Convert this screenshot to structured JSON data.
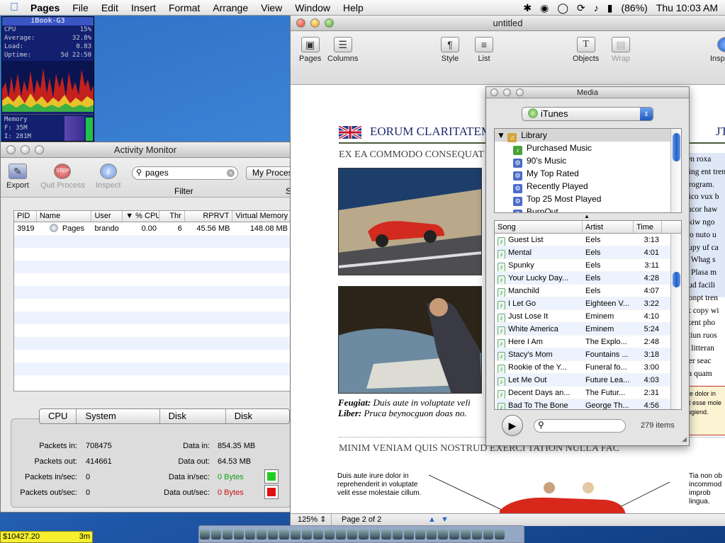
{
  "menubar": {
    "app": "Pages",
    "items": [
      "File",
      "Edit",
      "Insert",
      "Format",
      "Arrange",
      "View",
      "Window",
      "Help"
    ],
    "battery": "(86%)",
    "clock": "Thu 10:03 AM"
  },
  "ibook_widget": {
    "title": "iBook-G3",
    "rows": [
      {
        "label": "CPU",
        "value": "15%"
      },
      {
        "label": "Average:",
        "value": "32.8%"
      },
      {
        "label": "Load:",
        "value": "0.83"
      },
      {
        "label": "Uptime:",
        "value": "5d 22:50"
      }
    ],
    "memory_label": "Memory",
    "mem_f": "F: 35M",
    "mem_i": "I: 281M"
  },
  "activity_monitor": {
    "title": "Activity Monitor",
    "toolbar": {
      "export": "Export",
      "quit": "Quit Process",
      "inspect": "Inspect",
      "filter_label": "Filter",
      "search_value": "pages",
      "show_value": "My Processes"
    },
    "columns": [
      "PID",
      "Name",
      "User",
      "% CPU",
      "Thr",
      "RPRVT",
      "Virtual Memory"
    ],
    "rows": [
      {
        "pid": "3919",
        "name": "Pages",
        "user": "brando",
        "cpu": "0.00",
        "thr": "6",
        "rprvt": "45.56 MB",
        "vm": "148.08 MB"
      }
    ],
    "tabs": [
      "CPU",
      "System Memory",
      "Disk Activity",
      "Disk Usage"
    ],
    "stats": {
      "packets_in_label": "Packets in:",
      "packets_in": "708475",
      "packets_out_label": "Packets out:",
      "packets_out": "414661",
      "packets_in_sec_label": "Packets in/sec:",
      "packets_in_sec": "0",
      "packets_out_sec_label": "Packets out/sec:",
      "packets_out_sec": "0",
      "data_in_label": "Data in:",
      "data_in": "854.35 MB",
      "data_out_label": "Data out:",
      "data_out": "64.53 MB",
      "data_in_sec_label": "Data in/sec:",
      "data_in_sec": "0 Bytes",
      "data_out_sec_label": "Data out/sec:",
      "data_out_sec": "0 Bytes"
    }
  },
  "pages": {
    "title": "untitled",
    "toolbar": [
      "Pages",
      "Columns",
      "Style",
      "List",
      "Objects",
      "Wrap",
      "Inspector"
    ],
    "doc": {
      "heading1": "EORUM CLARITATEM",
      "heading2": "EX EA COMMODO CONSEQUAT",
      "caption_b1": "Feugiat:",
      "caption_t1": " Duis aute in voluptate veli",
      "caption_b2": "Liber:",
      "caption_t2": " Pruca beynocguon doas no.",
      "heading3": "MINIM VENIAM QUIS NOSTRUD EXERCI TATION NULLA FAC",
      "left_para": "Duis aute irure dolor in reprehenderit in voluptate velit esse molestaie cillum.",
      "right_para": "Tia non ob incommod improb lingua.",
      "side_text": [
        "len roxa",
        "king ent tren",
        "program.",
        "vico vux b",
        "rucor haw",
        "akiw ngo",
        "rto nuto u",
        "cupy uf ca",
        "t. Whag s",
        "t. Plasa m",
        "eud facili",
        "ponpt tren",
        "ix copy wi",
        "ixent pho",
        "ztiun ruos",
        "it litteran",
        "per seac",
        "ca quam"
      ],
      "box_text": [
        "re dolor in",
        "it esse mole",
        "ugiend."
      ],
      "jt": "JT"
    },
    "status": {
      "zoom": "125%",
      "page": "Page 2 of 2"
    }
  },
  "media": {
    "title": "Media",
    "source": "iTunes",
    "library": "Library",
    "playlists": [
      "Purchased Music",
      "90's Music",
      "My Top Rated",
      "Recently Played",
      "Top 25 Most Played",
      "BurnOut"
    ],
    "columns": [
      "Song",
      "Artist",
      "Time"
    ],
    "songs": [
      {
        "song": "Guest List",
        "artist": "Eels",
        "time": "3:13"
      },
      {
        "song": "Mental",
        "artist": "Eels",
        "time": "4:01"
      },
      {
        "song": "Spunky",
        "artist": "Eels",
        "time": "3:11"
      },
      {
        "song": "Your Lucky Day...",
        "artist": "Eels",
        "time": "4:28"
      },
      {
        "song": "Manchild",
        "artist": "Eels",
        "time": "4:07"
      },
      {
        "song": "I Let Go",
        "artist": "Eighteen V...",
        "time": "3:22"
      },
      {
        "song": "Just Lose It",
        "artist": "Eminem",
        "time": "4:10"
      },
      {
        "song": "White America",
        "artist": "Eminem",
        "time": "5:24"
      },
      {
        "song": "Here I Am",
        "artist": "The Explo...",
        "time": "2:48"
      },
      {
        "song": "Stacy's Mom",
        "artist": "Fountains ...",
        "time": "3:18"
      },
      {
        "song": "Rookie of the Y...",
        "artist": "Funeral fo...",
        "time": "3:00"
      },
      {
        "song": "Let Me Out",
        "artist": "Future Lea...",
        "time": "4:03"
      },
      {
        "song": "Decent Days an...",
        "artist": "The Futur...",
        "time": "2:31"
      },
      {
        "song": "Bad To The Bone",
        "artist": "George Th...",
        "time": "4:56"
      }
    ],
    "count": "279 items"
  },
  "stock": {
    "value": "$10427.20",
    "time": "3m"
  },
  "colors": {
    "accent": "#2a64c8",
    "green_led": "#22cc22",
    "red_led": "#dd1111"
  }
}
